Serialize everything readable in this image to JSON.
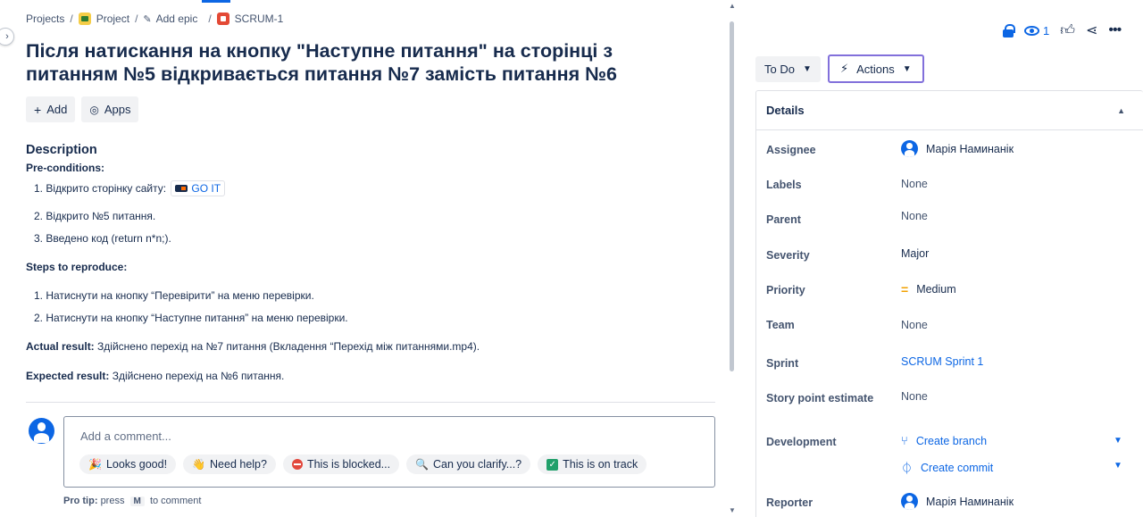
{
  "breadcrumb": {
    "projects": "Projects",
    "project": "Project",
    "add_epic": "Add epic",
    "issue_key": "SCRUM-1"
  },
  "issue": {
    "title": "Після натискання на кнопку \"Наступне питання\" на сторінці з питанням №5 відкривається питання №7 замість питання №6"
  },
  "toolbar": {
    "add_label": "Add",
    "apps_label": "Apps"
  },
  "description": {
    "heading": "Description",
    "preconditions_label": "Pre-conditions:",
    "pre_1_text": "1. Відкрито сторінку сайту:",
    "pre_1_link": "GO IT",
    "pre_2": "2. Відкрито №5 питання.",
    "pre_3": "3. Введено код (return n*n;).",
    "steps_label": "Steps to reproduce:",
    "step_1": "1. Натиснути на кнопку “Перевірити” на меню перевірки.",
    "step_2": "2. Натиснути на кнопку “Наступне питання” на меню перевірки.",
    "actual_label": "Actual result:",
    "actual_text": " Здійснено перехід на №7 питання (Вкладення “Перехід між питаннями.mp4).",
    "expected_label": "Expected result:",
    "expected_text": " Здійснено перехід на №6 питання."
  },
  "comment": {
    "placeholder": "Add a comment...",
    "chips": [
      "Looks good!",
      "Need help?",
      "This is blocked...",
      "Can you clarify...?",
      "This is on track"
    ],
    "protip_label": "Pro tip:",
    "protip_pre": "press",
    "protip_key": "M",
    "protip_post": "to comment"
  },
  "header_actions": {
    "watchers_count": "1"
  },
  "status": {
    "label": "To Do",
    "actions_label": "Actions"
  },
  "details": {
    "heading": "Details",
    "rows": {
      "assignee": {
        "label": "Assignee",
        "value": "Марія Наминанік"
      },
      "labels": {
        "label": "Labels",
        "value": "None"
      },
      "parent": {
        "label": "Parent",
        "value": "None"
      },
      "severity": {
        "label": "Severity",
        "value": "Major"
      },
      "priority": {
        "label": "Priority",
        "value": "Medium"
      },
      "team": {
        "label": "Team",
        "value": "None"
      },
      "sprint": {
        "label": "Sprint",
        "value": "SCRUM Sprint 1"
      },
      "story_points": {
        "label": "Story point estimate",
        "value": "None"
      },
      "development": {
        "label": "Development",
        "create_branch": "Create branch",
        "create_commit": "Create commit"
      },
      "reporter": {
        "label": "Reporter",
        "value": "Марія Наминанік"
      }
    }
  },
  "colors": {
    "accent": "#0c66e4",
    "actions_border": "#8270db",
    "priority_medium": "#f2a100"
  }
}
